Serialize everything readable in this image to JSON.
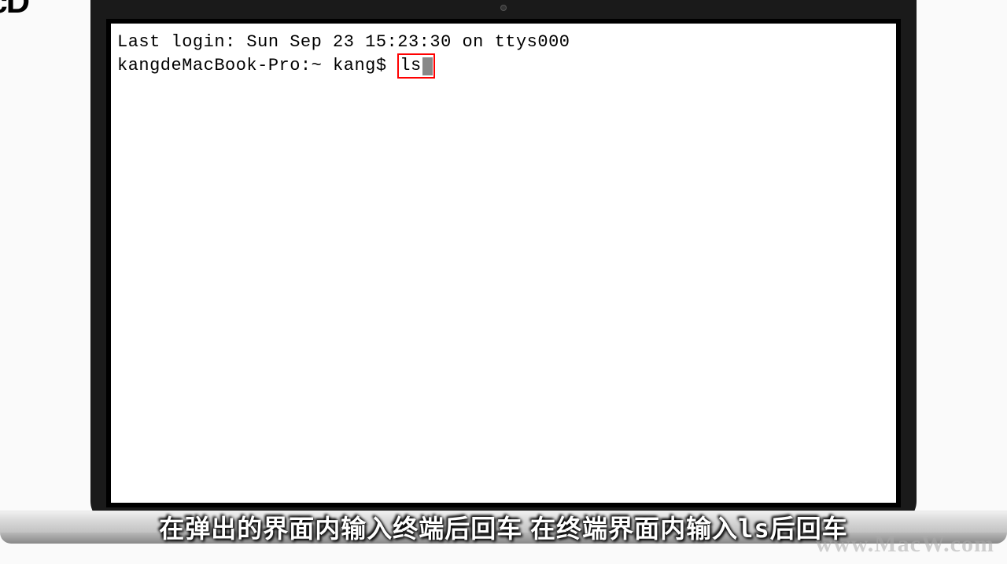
{
  "corner_text_fragment": "acD",
  "terminal": {
    "last_login": "Last login: Sun Sep 23 15:23:30 on ttys000",
    "prompt": "kangdeMacBook-Pro:~ kang$ ",
    "command": "ls"
  },
  "caption": {
    "left": "在弹出的界面内输入终端后回车 在终端界面内输入",
    "command": "ls",
    "right": "后回车"
  },
  "watermark": "www.MacW.com"
}
